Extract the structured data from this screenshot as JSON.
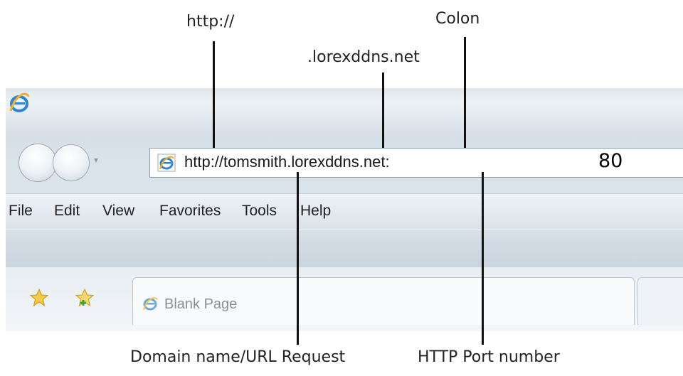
{
  "callouts": {
    "protocol": "http://",
    "colon": "Colon",
    "ddns": ".lorexddns.net",
    "domain": "Domain name/URL Request",
    "port": "HTTP Port number"
  },
  "browser": {
    "address_url": "http://tomsmith.lorexddns.net:",
    "address_port": "80",
    "menu": [
      "File",
      "Edit",
      "View",
      "Favorites",
      "Tools",
      "Help"
    ],
    "tab_label": "Blank Page"
  },
  "icons": {
    "app": "ie-logo-icon",
    "back": "back-button-icon",
    "forward": "forward-button-icon",
    "favorites": "favorites-star-icon",
    "add_favorite": "add-favorite-star-icon"
  }
}
